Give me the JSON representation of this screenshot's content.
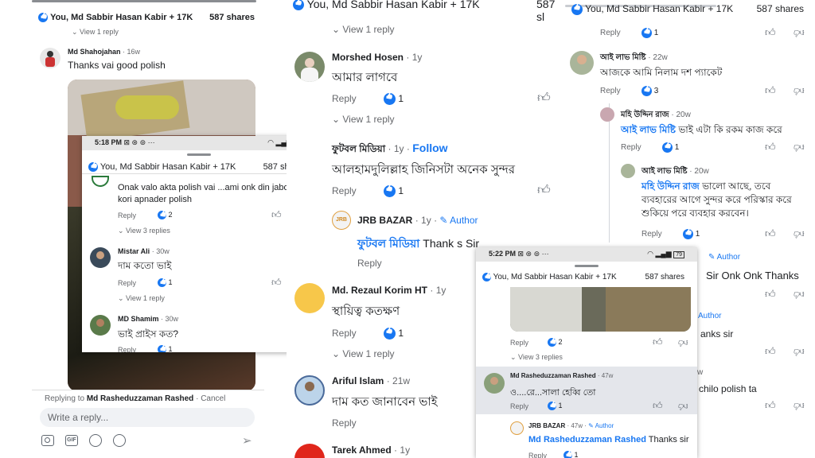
{
  "colors": {
    "accent": "#1877f2",
    "gray_text": "#65676b",
    "highlight": "#e4e6eb"
  },
  "panel_left": {
    "header": {
      "title": "You, Md Sabbir Hasan Kabir + 17K",
      "shares": "587 shares"
    },
    "view_reply_top": "View 1 reply",
    "comment1": {
      "author": "Md Shahojahan",
      "time": "16w",
      "text": "Thanks vai good polish"
    },
    "reply_bar": {
      "prefix": "Replying to",
      "name": "Md Rasheduzzaman Rashed",
      "separator": "·",
      "cancel": "Cancel"
    },
    "input_placeholder": "Write a reply...",
    "toolbar_icons": [
      "camera-icon",
      "gif-icon",
      "emoji-icon",
      "sticker-icon",
      "send-icon"
    ],
    "gif_label": "GIF"
  },
  "overlay_left": {
    "status": {
      "time": "5:18 PM",
      "battery": "79"
    },
    "header": {
      "title": "You, Md Sabbir Hasan Kabir + 17K",
      "shares": "587 shares"
    },
    "comments": [
      {
        "text": "Onak valo akta polish vai ...ami onk din jabot use kori apnader polish",
        "reply": "Reply",
        "likes": "2",
        "view": "View 3 replies"
      },
      {
        "author": "Mistar Ali",
        "time": "30w",
        "text": "দাম কতো ভাই",
        "reply": "Reply",
        "likes": "1",
        "view": "View 1 reply"
      },
      {
        "author": "MD Shamim",
        "time": "30w",
        "text": "ভাই প্রাইস কত?",
        "reply": "Reply",
        "likes": "1"
      }
    ]
  },
  "panel_middle": {
    "header": {
      "title": "You, Md Sabbir Hasan Kabir + 17K",
      "shares": "587 sl"
    },
    "view1": "View 1 reply",
    "c1": {
      "author": "Morshed Hosen",
      "time": "1y",
      "text": "আমার লাগবে",
      "reply": "Reply",
      "likes": "1"
    },
    "view2": "View 1 reply",
    "c2": {
      "author": "ফুটবল মিডিয়া",
      "time": "1y",
      "follow": "Follow",
      "text": "আলহামদুলিল্লাহ জিনিসটা অনেক সুন্দর",
      "reply": "Reply",
      "likes": "1"
    },
    "c3": {
      "author": "JRB BAZAR",
      "time": "1y",
      "badge": "Author",
      "mention": "ফুটবল মিডিয়া",
      "text": "Thank s Sir",
      "reply": "Reply",
      "logo": "JRB"
    },
    "c4": {
      "author": "Md. Rezaul Korim HT",
      "time": "1y",
      "text": "স্থায়িত্ব কতক্ষণ",
      "reply": "Reply",
      "likes": "1"
    },
    "view3": "View 1 reply",
    "c5": {
      "author": "Ariful Islam",
      "time": "21w",
      "text": "দাম কত জানাবেন ভাই",
      "reply": "Reply"
    },
    "c6": {
      "author": "Tarek Ahmed",
      "time": "1y"
    }
  },
  "panel_right": {
    "header": {
      "title": "You, Md Sabbir Hasan Kabir + 17K",
      "shares": "587 shares"
    },
    "r0": {
      "reply": "Reply",
      "likes": "1"
    },
    "c1": {
      "author": "আই লাভ মিষ্টি",
      "time": "22w",
      "text": "আজকে আমি নিলাম দশ প্যাকেট",
      "reply": "Reply",
      "likes": "3"
    },
    "c2": {
      "author": "মহি উদ্দিন রাজ",
      "time": "20w",
      "mention": "আই লাভ মিষ্টি",
      "text": "ভাই এটা কি রকম কাজ করে",
      "reply": "Reply",
      "likes": "1"
    },
    "c3": {
      "author": "আই লাভ মিষ্টি",
      "time": "20w",
      "mention": "মহি উদ্দিন রাজ",
      "text": "ভালো আছে, তবে ব্যবহারের আগে সুন্দর করে পরিস্কার করে শুকিয়ে পরে ব্যবহার করবেন।",
      "reply": "Reply",
      "likes": "1"
    },
    "c4": {
      "badge": "Author",
      "text": "Sir Onk Onk Thanks"
    },
    "c5": {
      "badge": "Author",
      "text": "anks sir"
    },
    "c6": {
      "time": "w",
      "text": "chilo polish ta"
    }
  },
  "overlay_right": {
    "status": {
      "time": "5:22 PM",
      "battery": "79"
    },
    "header": {
      "title": "You, Md Sabbir Hasan Kabir + 17K",
      "shares": "587 shares"
    },
    "r0": {
      "reply": "Reply",
      "likes": "2",
      "view": "View 3 replies"
    },
    "c1": {
      "author": "Md Rasheduzzaman Rashed",
      "time": "47w",
      "text": "ও....রে...সালা হেব্বি তো",
      "reply": "Reply",
      "likes": "1"
    },
    "c2": {
      "author": "JRB BAZAR",
      "time": "47w",
      "badge": "Author",
      "mention": "Md Rasheduzzaman Rashed",
      "text": "Thanks sir",
      "reply": "Reply",
      "likes": "1"
    }
  }
}
